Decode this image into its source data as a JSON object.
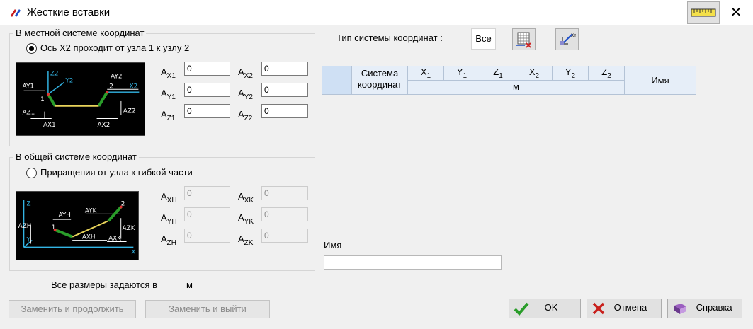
{
  "window": {
    "title": "Жесткие вставки",
    "close_glyph": "✕"
  },
  "local_group": {
    "title": "В местной системе координат",
    "radio_label": "Ось X2 проходит от узла 1 к узлу 2",
    "fields": [
      {
        "label_main": "A",
        "label_sub": "X1",
        "value": "0"
      },
      {
        "label_main": "A",
        "label_sub": "X2",
        "value": "0"
      },
      {
        "label_main": "A",
        "label_sub": "Y1",
        "value": "0"
      },
      {
        "label_main": "A",
        "label_sub": "Y2",
        "value": "0"
      },
      {
        "label_main": "A",
        "label_sub": "Z1",
        "value": "0"
      },
      {
        "label_main": "A",
        "label_sub": "Z2",
        "value": "0"
      }
    ],
    "diagram_labels": {
      "z2": "Z2",
      "y2": "Y2",
      "x2": "X2",
      "ay1": "AY1",
      "ay2": "AY2",
      "n1": "1",
      "n2": "2",
      "az1": "AZ1",
      "az2": "AZ2",
      "ax1": "AX1",
      "ax2": "AX2"
    }
  },
  "global_group": {
    "title": "В общей системе координат",
    "radio_label": "Приращения от узла к гибкой части",
    "fields": [
      {
        "label_main": "A",
        "label_sub": "XH",
        "value": "0"
      },
      {
        "label_main": "A",
        "label_sub": "XK",
        "value": "0"
      },
      {
        "label_main": "A",
        "label_sub": "YH",
        "value": "0"
      },
      {
        "label_main": "A",
        "label_sub": "YK",
        "value": "0"
      },
      {
        "label_main": "A",
        "label_sub": "ZH",
        "value": "0"
      },
      {
        "label_main": "A",
        "label_sub": "ZK",
        "value": "0"
      }
    ],
    "diagram_labels": {
      "z": "Z",
      "y": "Y",
      "x": "X",
      "ayh": "AYH",
      "ayk": "AYK",
      "n1": "1",
      "n2": "2",
      "azh": "AZH",
      "azk": "AZK",
      "axh": "AXH",
      "axk": "AXK"
    }
  },
  "units": {
    "label": "Все размеры задаются в",
    "value": "м"
  },
  "coord_type": {
    "label": "Тип системы координат :",
    "value": "Все"
  },
  "table": {
    "col_system": "Система координат",
    "cols": [
      {
        "main": "X",
        "sub": "1"
      },
      {
        "main": "Y",
        "sub": "1"
      },
      {
        "main": "Z",
        "sub": "1"
      },
      {
        "main": "X",
        "sub": "2"
      },
      {
        "main": "Y",
        "sub": "2"
      },
      {
        "main": "Z",
        "sub": "2"
      }
    ],
    "unit": "м",
    "col_name": "Имя"
  },
  "name_field": {
    "label": "Имя",
    "value": ""
  },
  "buttons": {
    "replace_continue": "Заменить и продолжить",
    "replace_exit": "Заменить и выйти",
    "ok": "OK",
    "cancel": "Отмена",
    "help": "Справка"
  },
  "icons": {
    "app": "stiff-insert-app-icon",
    "ruler": "ruler-icon",
    "grid_select": "grid-select-icon",
    "axes": "coordinate-axes-icon",
    "ok": "checkmark-icon",
    "cancel": "cross-icon",
    "help": "help-book-icon"
  },
  "colors": {
    "accent_green": "#2a9d2a",
    "cancel_red": "#c8201c",
    "table_header": "#e6eef8"
  }
}
